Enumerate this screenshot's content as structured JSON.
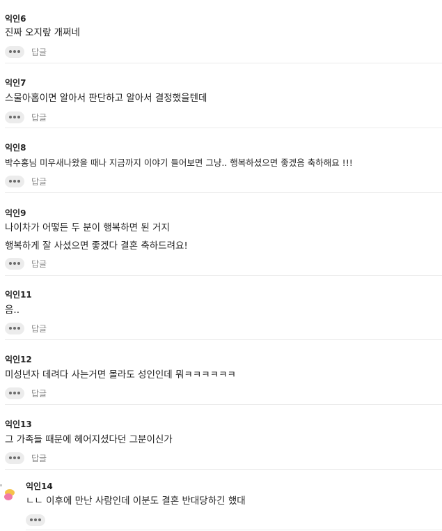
{
  "comments": [
    {
      "author": "익인6",
      "lines": [
        "진짜 오지랖 개쩌네"
      ],
      "reply_label": "답글"
    },
    {
      "author": "익인7",
      "lines": [
        "스물아홉이면 알아서 판단하고 알아서 결정했을텐데"
      ],
      "reply_label": "답글"
    },
    {
      "author": "익인8",
      "lines": [
        "박수홍님 미우새나왔을 때나 지금까지 이야기 들어보면 그냥.. 행복하셨으면 좋겠음 축하해요 !!!"
      ],
      "reply_label": "답글"
    },
    {
      "author": "익인9",
      "lines": [
        "나이차가 어떻든 두 분이 행복하면 된 거지",
        "행복하게 잘 사셨으면 좋겠다 결혼 축하드려요!"
      ],
      "reply_label": "답글"
    },
    {
      "author": "익인11",
      "lines": [
        "음.."
      ],
      "reply_label": "답글"
    },
    {
      "author": "익인12",
      "lines": [
        "미성년자 데려다 사는거면 몰라도 성인인데 뭐ㅋㅋㅋㅋㅋㅋ"
      ],
      "reply_label": "답글"
    },
    {
      "author": "익인13",
      "lines": [
        "그 가족들 때문에 헤어지셨다던 그분이신가"
      ],
      "reply_label": "답글"
    },
    {
      "author": "익인14",
      "lines": [
        "ㄴㄴ 이후에 만난 사람인데 이분도 결혼 반대당하긴 했대"
      ],
      "reply_label": ""
    }
  ],
  "icons": {
    "more": "more-dots-icon",
    "avatar": "avatar-icon"
  }
}
